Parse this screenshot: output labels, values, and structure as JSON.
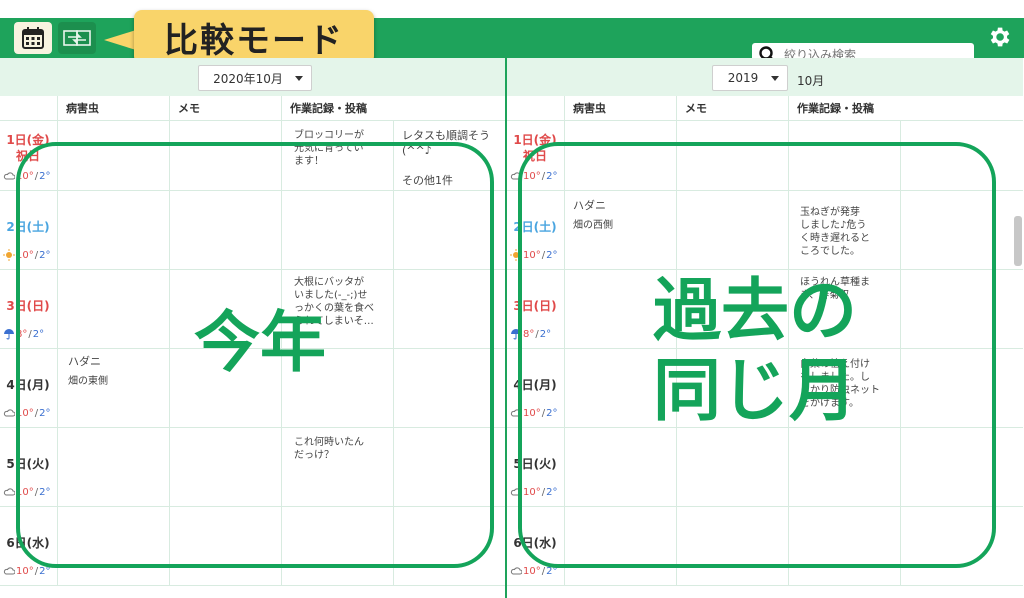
{
  "colors": {
    "brand_green": "#1ea35b",
    "callout_yellow": "#f9d46a",
    "sunday_red": "#e04a4a",
    "saturday_blue": "#4aa5e0",
    "hi_temp": "#e04a4a",
    "lo_temp": "#3a6fd0"
  },
  "toolbar": {
    "calendar_icon": "calendar-icon",
    "compare_icon": "compare-calendars-icon",
    "compare_mode_label": "比較モード",
    "search_placeholder": "絞り込み検索",
    "settings_icon": "gear-icon"
  },
  "left_pane": {
    "month_select": "2020年10月",
    "headers": [
      "病害虫",
      "メモ",
      "作業記録・投稿"
    ],
    "days": [
      {
        "date": "1日(金)",
        "note": "祝日",
        "weather": "cloud",
        "hi": "10°",
        "lo": "2°"
      },
      {
        "date": "2日(土)",
        "weather": "sun",
        "hi": "10°",
        "lo": "2°"
      },
      {
        "date": "3日(日)",
        "weather": "umbrella",
        "hi": "8°",
        "lo": "2°"
      },
      {
        "date": "4日(月)",
        "weather": "cloud",
        "hi": "10°",
        "lo": "2°"
      },
      {
        "date": "5日(火)",
        "weather": "cloud",
        "hi": "10°",
        "lo": "2°"
      },
      {
        "date": "6日(水)",
        "weather": "cloud",
        "hi": "10°",
        "lo": "2°"
      }
    ],
    "entries": {
      "r1_post1": "ブロッコリーが\n元気に育ってい\nます！",
      "r1_post2": "レタスも順調そう\n(^^♪\n\nその他1件",
      "r3_post1": "大根にバッタが\nいました(-_-;)せ\nっかくの葉を食べ\nられてしまいそ…",
      "r4_pest": "ハダニ",
      "r4_pest_sub": "畑の東側",
      "r5_post1": "これ何時いたん\nだっけ？"
    },
    "overlay_label": "今年"
  },
  "right_pane": {
    "year_select": "2019",
    "month_label": "10月",
    "headers": [
      "病害虫",
      "メモ",
      "作業記録・投稿"
    ],
    "days": [
      {
        "date": "1日(金)",
        "note": "祝日",
        "weather": "cloud",
        "hi": "10°",
        "lo": "2°"
      },
      {
        "date": "2日(土)",
        "weather": "sun",
        "hi": "10°",
        "lo": "2°"
      },
      {
        "date": "3日(日)",
        "weather": "umbrella",
        "hi": "8°",
        "lo": "2°"
      },
      {
        "date": "4日(月)",
        "weather": "cloud",
        "hi": "10°",
        "lo": "2°"
      },
      {
        "date": "5日(火)",
        "weather": "cloud",
        "hi": "10°",
        "lo": "2°"
      },
      {
        "date": "6日(水)",
        "weather": "cloud",
        "hi": "10°",
        "lo": "2°"
      }
    ],
    "entries": {
      "r2_pest": "ハダニ",
      "r2_pest_sub": "畑の西側",
      "r2_post1": "玉ねぎが発芽\nしました♪危う\nく時き遅れると\nころでした。",
      "r3_post1": "ほうれん草種ま\nき、春菊収",
      "r4_post1": "白菜の植え付け\nをしました。し\nっかり防虫ネット\nをかけます。"
    },
    "overlay_label_line1": "過去の",
    "overlay_label_line2": "同じ月"
  }
}
